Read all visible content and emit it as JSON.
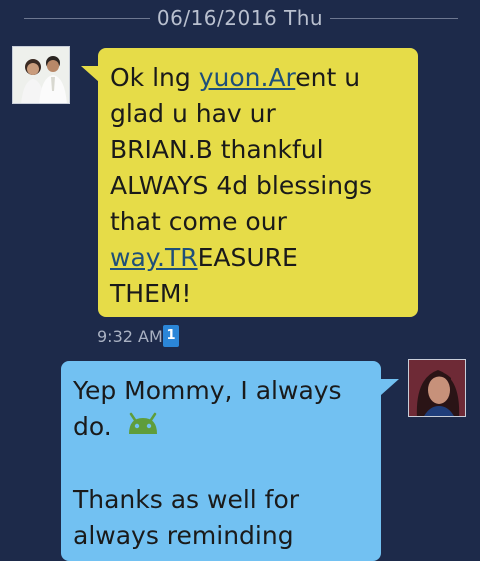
{
  "date_separator": "06/16/2016 Thu",
  "incoming": {
    "lines": [
      [
        "Ok lng ",
        "yuon.Ar",
        "ent u"
      ],
      [
        "glad u hav ur"
      ],
      [
        "BRIAN.B thankful"
      ],
      [
        "ALWAYS 4d blessings"
      ],
      [
        "that come our"
      ],
      [
        "way.TR",
        "EASURE"
      ],
      [
        "THEM!"
      ]
    ],
    "time": "9:32 AM",
    "count": "1"
  },
  "outgoing": {
    "line1": "Yep Mommy, I always",
    "line2": "do.",
    "line3": "Thanks as well for",
    "line4": "always reminding",
    "emoji_icon": "android-icon"
  },
  "colors": {
    "background": "#1d2a4a",
    "incoming_bubble": "#e6dc48",
    "outgoing_bubble": "#72c1f2",
    "link": "#1e4f7a"
  }
}
